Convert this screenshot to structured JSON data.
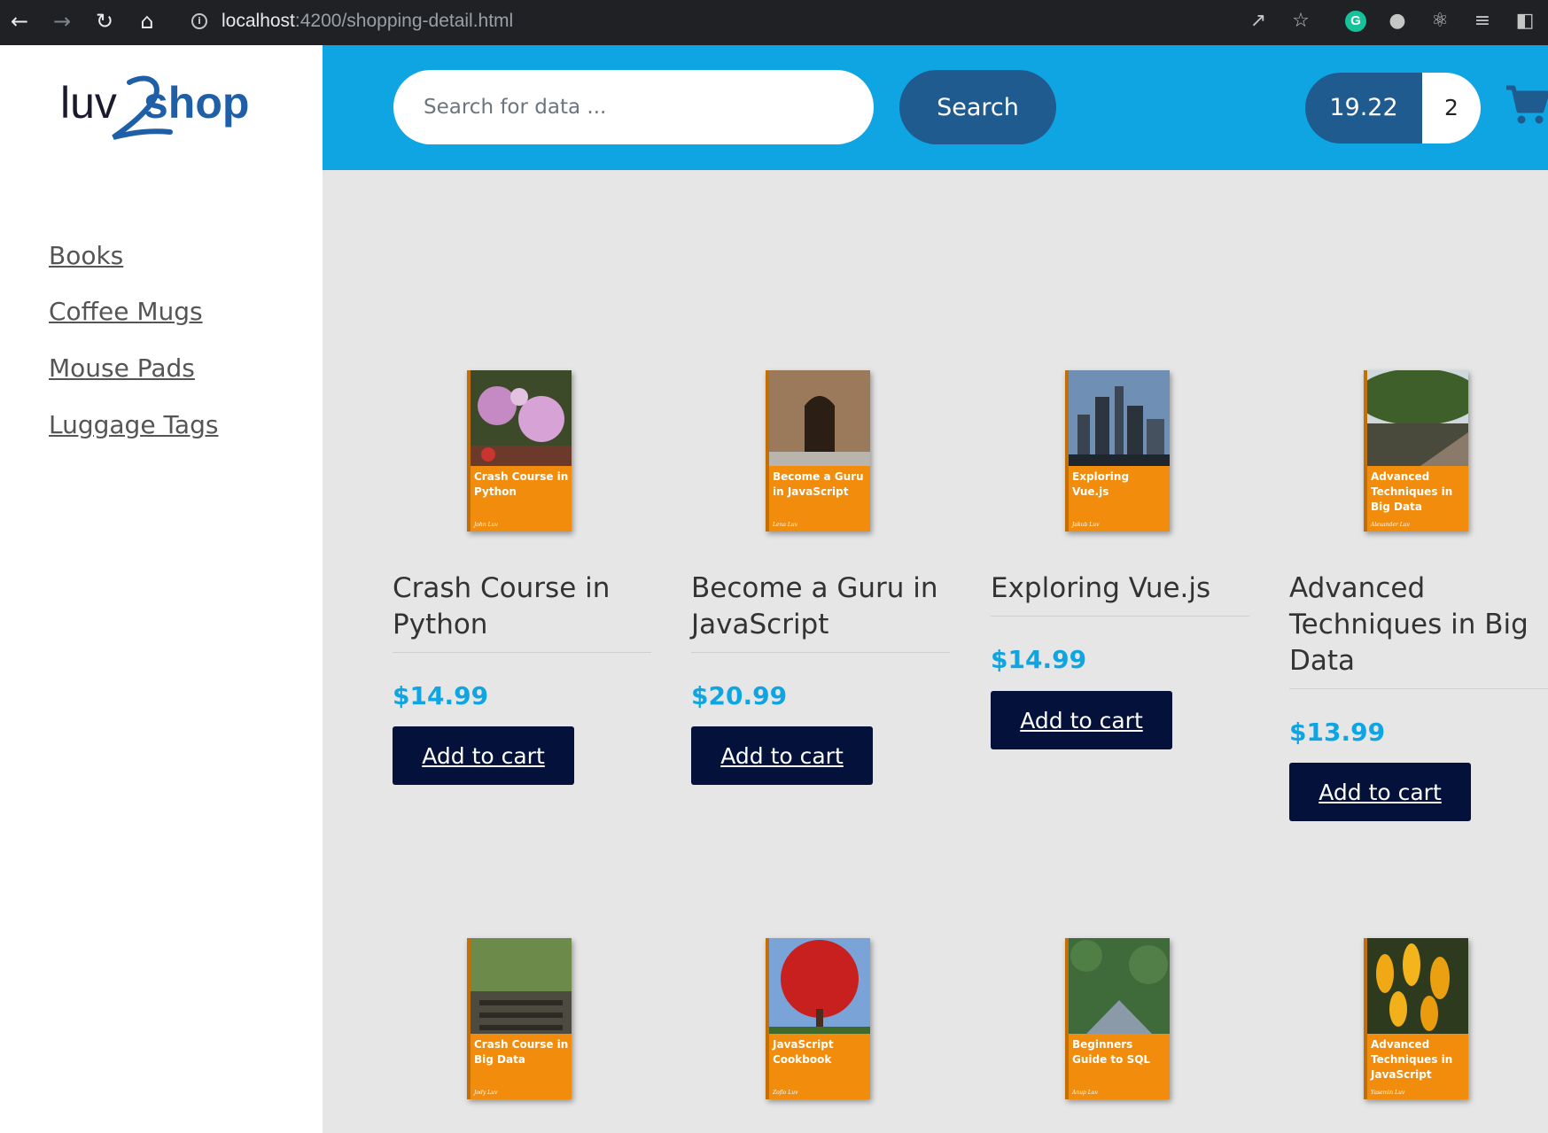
{
  "browser": {
    "url_host": "localhost",
    "url_path": ":4200/shopping-detail.html"
  },
  "logo": {
    "text_part1": "luv",
    "text_part2": "shop",
    "numeral": "2"
  },
  "sidebar": {
    "items": [
      {
        "label": "Books"
      },
      {
        "label": "Coffee Mugs"
      },
      {
        "label": "Mouse Pads"
      },
      {
        "label": "Luggage Tags"
      }
    ]
  },
  "header": {
    "search_placeholder": "Search for data ...",
    "search_button": "Search",
    "cart_total": "19.22",
    "cart_quantity": "2"
  },
  "colors": {
    "header_bg": "#0ea5e2",
    "button_dark": "#04113a",
    "price": "#0ea5e2",
    "cover_orange": "#f18c0c"
  },
  "products": [
    {
      "title": "Crash Course in Python",
      "price": "$14.99",
      "button": "Add to cart",
      "cover_title": "Crash Course in Python",
      "cover_author": "John Luv"
    },
    {
      "title": "Become a Guru in JavaScript",
      "price": "$20.99",
      "button": "Add to cart",
      "cover_title": "Become a Guru in JavaScript",
      "cover_author": "Lena Luv"
    },
    {
      "title": "Exploring Vue.js",
      "price": "$14.99",
      "button": "Add to cart",
      "cover_title": "Exploring Vue.js",
      "cover_author": "Jakub Luv"
    },
    {
      "title": "Advanced Techniques in Big Data",
      "price": "$13.99",
      "button": "Add to cart",
      "cover_title": "Advanced Techniques in Big Data",
      "cover_author": "Alexander Luv"
    },
    {
      "cover_title": "Crash Course in Big Data",
      "cover_author": "Jody Luv"
    },
    {
      "cover_title": "JavaScript Cookbook",
      "cover_author": "Zoflo Luv"
    },
    {
      "cover_title": "Beginners Guide to SQL",
      "cover_author": "Anup Luv"
    },
    {
      "cover_title": "Advanced Techniques in JavaScript",
      "cover_author": "Yasemin Luv"
    }
  ]
}
